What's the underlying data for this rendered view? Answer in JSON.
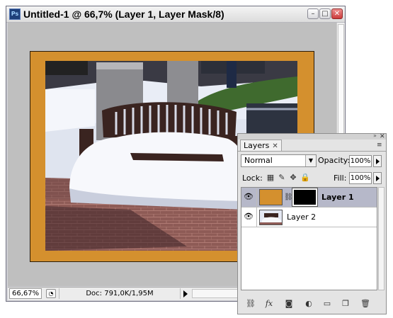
{
  "document": {
    "title": "Untitled-1 @ 66,7% (Layer 1, Layer Mask/8)",
    "app_icon_text": "Ps",
    "zoom": "66,67%",
    "doc_info": "Doc: 791,0K/1,95M"
  },
  "window_buttons": {
    "minimize": "–",
    "maximize": "□",
    "close": "✕"
  },
  "colors": {
    "frame_orange": "#d4902e",
    "selection": "#b6b8c9"
  },
  "layers_panel": {
    "tab_label": "Layers",
    "tab_close": "✕",
    "collapse_glyph": "»",
    "close_glyph": "✕",
    "menu_glyph": "≡",
    "blend_mode": "Normal",
    "opacity_label": "Opacity:",
    "opacity_value": "100%",
    "lock_label": "Lock:",
    "fill_label": "Fill:",
    "fill_value": "100%",
    "lock_icons": [
      "transparent-pixels-icon",
      "brush-icon",
      "move-icon",
      "lock-icon"
    ],
    "layers": [
      {
        "name": "Layer 1",
        "selected": true,
        "visible": true,
        "has_mask": true
      },
      {
        "name": "Layer 2",
        "selected": false,
        "visible": true,
        "has_mask": false
      }
    ],
    "footer_icons": [
      "link-layers-icon",
      "fx-icon",
      "add-mask-icon",
      "adjustment-layer-icon",
      "new-group-icon",
      "new-layer-icon",
      "trash-icon"
    ]
  }
}
